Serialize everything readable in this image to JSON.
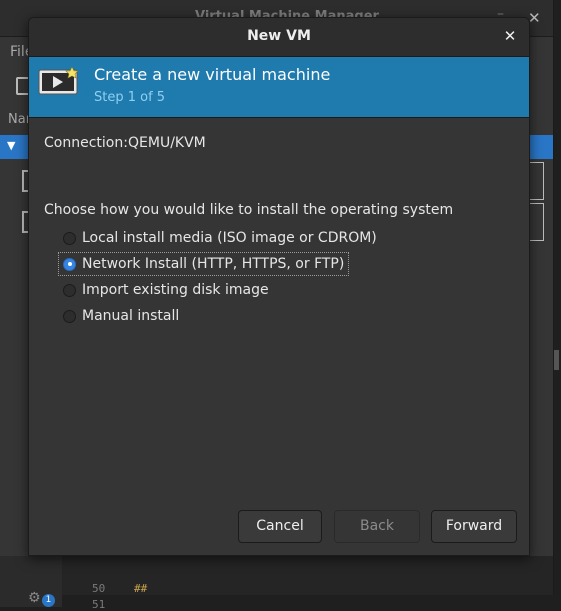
{
  "background_window": {
    "title": "Virtual Machine Manager",
    "menu_first": "File",
    "column_header": "Name",
    "editor_lines": [
      "50",
      "51"
    ],
    "editor_code": "##",
    "notification_count": "1"
  },
  "dialog": {
    "title": "New VM",
    "header": {
      "title": "Create a new virtual machine",
      "step": "Step 1 of 5"
    },
    "connection": {
      "label": "Connection:",
      "value": "QEMU/KVM"
    },
    "install_prompt": "Choose how you would like to install the operating system",
    "install_options": [
      {
        "label": "Local install media (ISO image or CDROM)",
        "selected": false
      },
      {
        "label": "Network Install (HTTP, HTTPS, or FTP)",
        "selected": true
      },
      {
        "label": "Import existing disk image",
        "selected": false
      },
      {
        "label": "Manual install",
        "selected": false
      }
    ],
    "buttons": {
      "cancel": "Cancel",
      "back": "Back",
      "forward": "Forward"
    }
  },
  "colors": {
    "banner": "#1f7aad",
    "selection": "#2a76c6",
    "radio_checked": "#3584e4"
  }
}
